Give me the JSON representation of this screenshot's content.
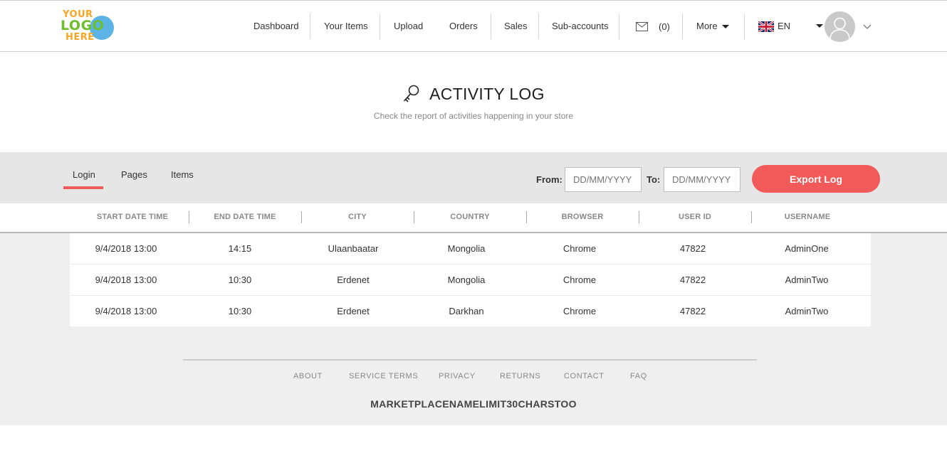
{
  "logo": {
    "line1": "YOUR",
    "line2": "LOGO",
    "line3": "HERE"
  },
  "nav": {
    "dashboard": "Dashboard",
    "your_items": "Your Items",
    "upload": "Upload",
    "orders": "Orders",
    "sales": "Sales",
    "sub_accounts": "Sub-accounts",
    "messages_count": "(0)",
    "more": "More",
    "language": "EN"
  },
  "page": {
    "title": "ACTIVITY LOG",
    "subtitle": "Check the report of activities happening in your store"
  },
  "tabs": [
    "Login",
    "Pages",
    "Items"
  ],
  "filters": {
    "from_label": "From:",
    "to_label": "To:",
    "from_placeholder": "DD/MM/YYYY",
    "to_placeholder": "DD/MM/YYYY",
    "export_label": "Export Log"
  },
  "table": {
    "columns": [
      "START DATE TIME",
      "END DATE TIME",
      "CITY",
      "COUNTRY",
      "BROWSER",
      "USER ID",
      "USERNAME"
    ],
    "rows": [
      [
        "9/4/2018 13:00",
        "14:15",
        "Ulaanbaatar",
        "Mongolia",
        "Chrome",
        "47822",
        "AdminOne"
      ],
      [
        "9/4/2018 13:00",
        "10:30",
        "Erdenet",
        "Mongolia",
        "Chrome",
        "47822",
        "AdminTwo"
      ],
      [
        "9/4/2018 13:00",
        "10:30",
        "Erdenet",
        "Darkhan",
        "Chrome",
        "47822",
        "AdminTwo"
      ]
    ]
  },
  "footer": {
    "links": [
      "ABOUT",
      "SERVICE TERMS",
      "PRIVACY",
      "RETURNS",
      "CONTACT",
      "FAQ"
    ],
    "marketplace_name": "MARKETPLACENAMELIMIT30CHARSTOO"
  },
  "colors": {
    "accent": "#f25a5a",
    "band": "#efefef",
    "toolbar": "#e6e6e6"
  }
}
